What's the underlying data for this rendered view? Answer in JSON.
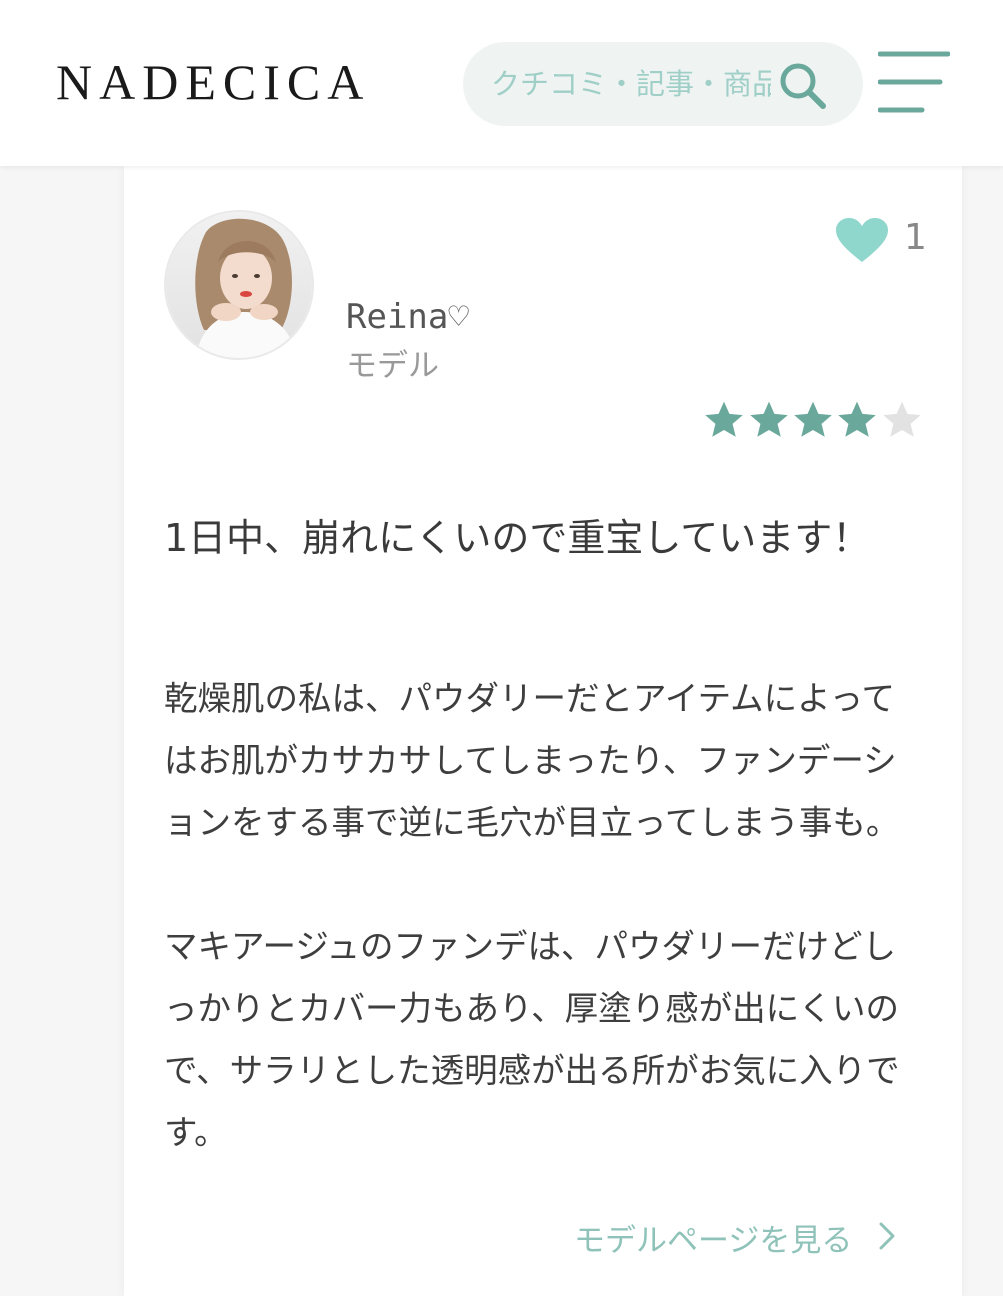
{
  "header": {
    "logo": "NADECICA",
    "search": {
      "placeholder": "クチコミ・記事・商品を検索",
      "icon": "search-icon"
    },
    "menu_icon": "menu-icon"
  },
  "colors": {
    "accent": "#6ba89c",
    "like": "#8fd6cc",
    "star_filled": "#6ba89c",
    "star_empty": "#e2e2e2",
    "link": "#8fc3b9"
  },
  "review": {
    "author": {
      "name": "Reina♡",
      "role": "モデル",
      "avatar_icon": "avatar-photo"
    },
    "likes": {
      "icon": "heart-icon",
      "count": "1"
    },
    "rating": {
      "value": 4,
      "max": 5
    },
    "title": "1日中、崩れにくいので重宝しています！",
    "paragraphs": [
      "乾燥肌の私は、パウダリーだとアイテムによってはお肌がカサカサしてしまったり、ファンデーションをする事で逆に毛穴が目立ってしまう事も。",
      "マキアージュのファンデは、パウダリーだけどしっかりとカバー力もあり、厚塗り感が出にくいので、サラリとした透明感が出る所がお気に入りです。"
    ],
    "model_link": "モデルページを見る"
  }
}
